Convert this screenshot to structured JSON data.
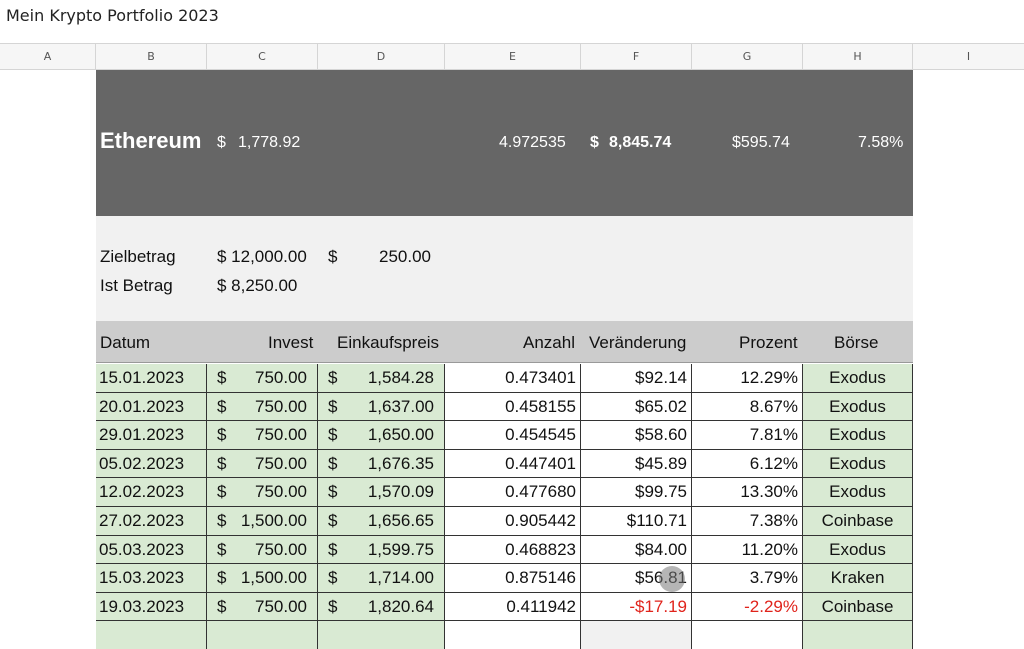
{
  "doc_title": "Mein Krypto Portfolio 2023",
  "columns": [
    "A",
    "B",
    "C",
    "D",
    "E",
    "F",
    "G",
    "H",
    "I"
  ],
  "banner": {
    "name": "Ethereum",
    "price_currency": "$",
    "price": "1,778.92",
    "quantity": "4.972535",
    "value_currency": "$",
    "value": "8,845.74",
    "gain": "$595.74",
    "gain_pct": "7.58%"
  },
  "goal": {
    "target_label": "Zielbetrag",
    "target_value": "$ 12,000.00",
    "monthly_currency": "$",
    "monthly_value": "250.00",
    "actual_label": "Ist Betrag",
    "actual_value": "$  8,250.00"
  },
  "table": {
    "headers": {
      "date": "Datum",
      "invest": "Invest",
      "buy_price": "Einkaufspreis",
      "quantity": "Anzahl",
      "change": "Veränderung",
      "percent": "Prozent",
      "exchange": "Börse"
    },
    "rows": [
      {
        "date": "15.01.2023",
        "invest": "750.00",
        "price": "1,584.28",
        "qty": "0.473401",
        "change": "$92.14",
        "pct": "12.29%",
        "exchange": "Exodus"
      },
      {
        "date": "20.01.2023",
        "invest": "750.00",
        "price": "1,637.00",
        "qty": "0.458155",
        "change": "$65.02",
        "pct": "8.67%",
        "exchange": "Exodus"
      },
      {
        "date": "29.01.2023",
        "invest": "750.00",
        "price": "1,650.00",
        "qty": "0.454545",
        "change": "$58.60",
        "pct": "7.81%",
        "exchange": "Exodus"
      },
      {
        "date": "05.02.2023",
        "invest": "750.00",
        "price": "1,676.35",
        "qty": "0.447401",
        "change": "$45.89",
        "pct": "6.12%",
        "exchange": "Exodus"
      },
      {
        "date": "12.02.2023",
        "invest": "750.00",
        "price": "1,570.09",
        "qty": "0.477680",
        "change": "$99.75",
        "pct": "13.30%",
        "exchange": "Exodus"
      },
      {
        "date": "27.02.2023",
        "invest": "1,500.00",
        "price": "1,656.65",
        "qty": "0.905442",
        "change": "$110.71",
        "pct": "7.38%",
        "exchange": "Coinbase"
      },
      {
        "date": "05.03.2023",
        "invest": "750.00",
        "price": "1,599.75",
        "qty": "0.468823",
        "change": "$84.00",
        "pct": "11.20%",
        "exchange": "Exodus"
      },
      {
        "date": "15.03.2023",
        "invest": "1,500.00",
        "price": "1,714.00",
        "qty": "0.875146",
        "change": "$56.81",
        "pct": "3.79%",
        "exchange": "Kraken"
      },
      {
        "date": "19.03.2023",
        "invest": "750.00",
        "price": "1,820.64",
        "qty": "0.411942",
        "change": "-$17.19",
        "pct": "-2.29%",
        "exchange": "Coinbase",
        "negative": true
      },
      {
        "date": "",
        "invest": "",
        "price": "",
        "qty": "",
        "change": "",
        "pct": "",
        "exchange": "",
        "empty": true
      }
    ],
    "currency_symbol": "$"
  },
  "colors": {
    "banner_bg": "#666666",
    "goal_bg": "#f1f1f1",
    "header_bg": "#cccccc",
    "input_green": "#d9ead3",
    "negative": "#e0231b"
  }
}
